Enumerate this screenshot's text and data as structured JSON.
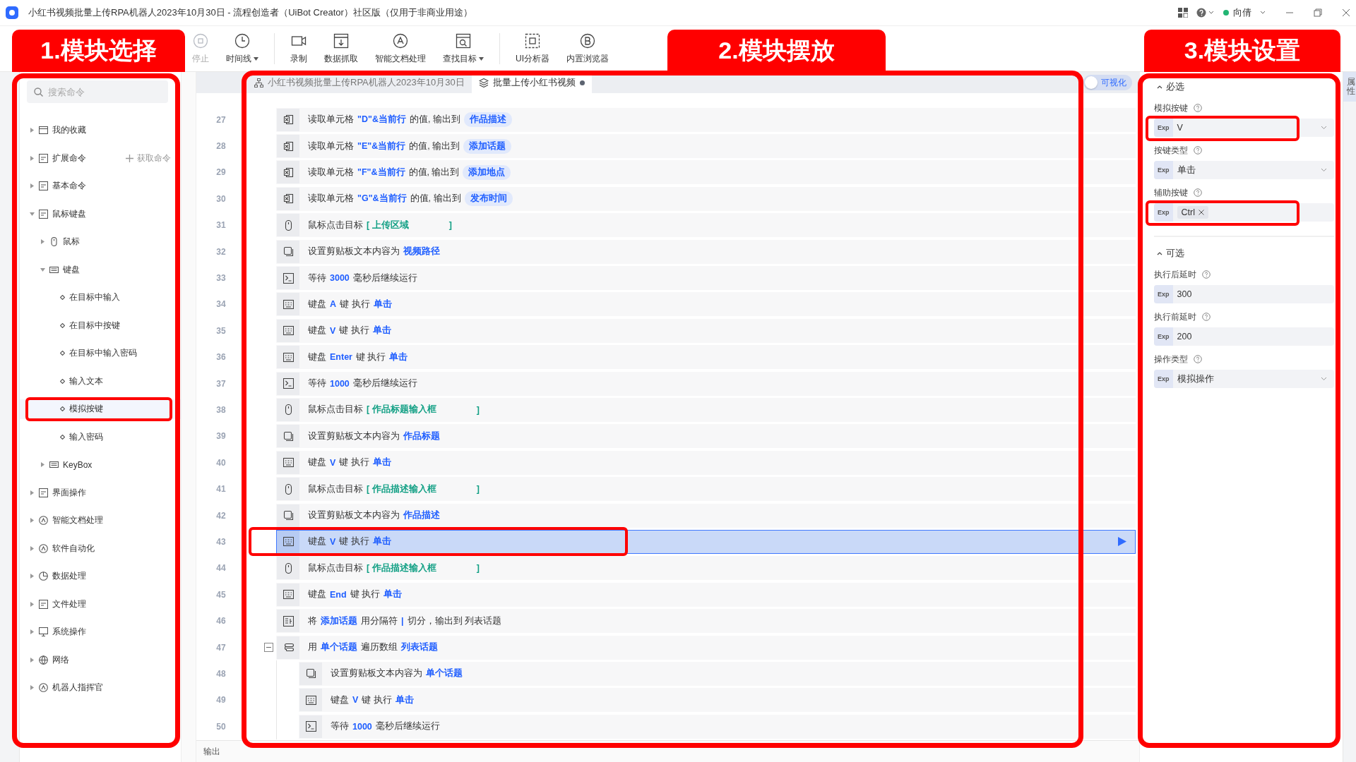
{
  "window": {
    "title": "小红书视频批量上传RPA机器人2023年10月30日 - 流程创造者（UiBot Creator）社区版（仅用于非商业用途）",
    "user": "向倩"
  },
  "toolbar": [
    {
      "label": "停止",
      "kind": "stop",
      "disabled": true,
      "dropdown": false
    },
    {
      "label": "时间线",
      "kind": "timeline",
      "disabled": false,
      "dropdown": true
    },
    {
      "label": "录制",
      "kind": "record",
      "disabled": false,
      "dropdown": false
    },
    {
      "label": "数据抓取",
      "kind": "scrape",
      "disabled": false,
      "dropdown": false
    },
    {
      "label": "智能文档处理",
      "kind": "ai-doc",
      "disabled": false,
      "dropdown": false
    },
    {
      "label": "查找目标",
      "kind": "find",
      "disabled": false,
      "dropdown": true
    },
    {
      "label": "UI分析器",
      "kind": "ui-analyzer",
      "disabled": false,
      "dropdown": false
    },
    {
      "label": "内置浏览器",
      "kind": "browser",
      "disabled": false,
      "dropdown": false
    }
  ],
  "annotations": [
    {
      "label": "1.模块选择"
    },
    {
      "label": "2.模块摆放"
    },
    {
      "label": "3.模块设置"
    }
  ],
  "sidebar": {
    "search_placeholder": "搜索命令",
    "get_commands": "获取命令",
    "items": [
      {
        "label": "我的收藏",
        "kind": "folder",
        "expanded": false
      },
      {
        "label": "扩展命令",
        "kind": "extension",
        "expanded": false
      },
      {
        "label": "基本命令",
        "kind": "code",
        "expanded": false
      },
      {
        "label": "鼠标键盘",
        "kind": "mouse-keyboard",
        "expanded": true,
        "children": [
          {
            "label": "鼠标",
            "kind": "mouse",
            "expanded": false
          },
          {
            "label": "键盘",
            "kind": "keyboard",
            "expanded": true,
            "children": [
              {
                "label": "在目标中输入",
                "kind": "command",
                "selected": false,
                "highlighted": false
              },
              {
                "label": "在目标中按键",
                "kind": "command",
                "selected": false,
                "highlighted": false
              },
              {
                "label": "在目标中输入密码",
                "kind": "command",
                "selected": false,
                "highlighted": false
              },
              {
                "label": "输入文本",
                "kind": "command",
                "selected": false,
                "highlighted": false
              },
              {
                "label": "模拟按键",
                "kind": "command",
                "selected": true,
                "highlighted": true
              },
              {
                "label": "输入密码",
                "kind": "command",
                "selected": false,
                "highlighted": false
              }
            ]
          },
          {
            "label": "KeyBox",
            "kind": "keybox",
            "expanded": false
          }
        ]
      },
      {
        "label": "界面操作",
        "kind": "ui",
        "expanded": false
      },
      {
        "label": "智能文档处理",
        "kind": "ai",
        "expanded": false
      },
      {
        "label": "软件自动化",
        "kind": "auto",
        "expanded": false
      },
      {
        "label": "数据处理",
        "kind": "chart",
        "expanded": false
      },
      {
        "label": "文件处理",
        "kind": "file",
        "expanded": false
      },
      {
        "label": "系统操作",
        "kind": "system",
        "expanded": false
      },
      {
        "label": "网络",
        "kind": "globe",
        "expanded": false
      },
      {
        "label": "机器人指挥官",
        "kind": "commander",
        "expanded": false
      }
    ]
  },
  "editor": {
    "tabs": [
      {
        "label": "小红书视频批量上传RPA机器人2023年10月30日",
        "kind": "flow",
        "selected": false,
        "modified": false
      },
      {
        "label": "批量上传小红书视频",
        "kind": "block",
        "selected": true,
        "modified": true
      }
    ],
    "visual_toggle": {
      "label": "可视化",
      "on": false
    },
    "rows": [
      {
        "line": "27",
        "kind": "read-cell",
        "selected": false,
        "highlighted": false,
        "parts": [
          {
            "kind": "text",
            "text": "读取单元格"
          },
          {
            "kind": "value",
            "text": "\"D\"&当前行"
          },
          {
            "kind": "text",
            "text": "的值, 输出到"
          },
          {
            "kind": "pill",
            "text": "作品描述"
          }
        ]
      },
      {
        "line": "28",
        "kind": "read-cell",
        "selected": false,
        "highlighted": false,
        "parts": [
          {
            "kind": "text",
            "text": "读取单元格"
          },
          {
            "kind": "value",
            "text": "\"E\"&当前行"
          },
          {
            "kind": "text",
            "text": "的值, 输出到"
          },
          {
            "kind": "pill",
            "text": "添加话题"
          }
        ]
      },
      {
        "line": "29",
        "kind": "read-cell",
        "selected": false,
        "highlighted": false,
        "parts": [
          {
            "kind": "text",
            "text": "读取单元格"
          },
          {
            "kind": "value",
            "text": "\"F\"&当前行"
          },
          {
            "kind": "text",
            "text": "的值, 输出到"
          },
          {
            "kind": "pill",
            "text": "添加地点"
          }
        ]
      },
      {
        "line": "30",
        "kind": "read-cell",
        "selected": false,
        "highlighted": false,
        "parts": [
          {
            "kind": "text",
            "text": "读取单元格"
          },
          {
            "kind": "value",
            "text": "\"G\"&当前行"
          },
          {
            "kind": "text",
            "text": "的值, 输出到"
          },
          {
            "kind": "pill",
            "text": "发布时间"
          }
        ]
      },
      {
        "line": "31",
        "kind": "click",
        "selected": false,
        "highlighted": false,
        "parts": [
          {
            "kind": "text",
            "text": "鼠标点击目标"
          },
          {
            "kind": "target",
            "text": "[ 上传区域"
          },
          {
            "kind": "target-end",
            "text": "]"
          }
        ]
      },
      {
        "line": "32",
        "kind": "clipboard",
        "selected": false,
        "highlighted": false,
        "parts": [
          {
            "kind": "text",
            "text": "设置剪贴板文本内容为"
          },
          {
            "kind": "value",
            "text": "视频路径"
          }
        ]
      },
      {
        "line": "33",
        "kind": "wait",
        "selected": false,
        "highlighted": false,
        "parts": [
          {
            "kind": "text",
            "text": "等待"
          },
          {
            "kind": "value",
            "text": "3000"
          },
          {
            "kind": "text",
            "text": "毫秒后继续运行"
          }
        ]
      },
      {
        "line": "34",
        "kind": "keyboard",
        "selected": false,
        "highlighted": false,
        "parts": [
          {
            "kind": "text",
            "text": "键盘"
          },
          {
            "kind": "value",
            "text": "A"
          },
          {
            "kind": "text",
            "text": "键 执行"
          },
          {
            "kind": "value",
            "text": "单击"
          }
        ]
      },
      {
        "line": "35",
        "kind": "keyboard",
        "selected": false,
        "highlighted": false,
        "parts": [
          {
            "kind": "text",
            "text": "键盘"
          },
          {
            "kind": "value",
            "text": "V"
          },
          {
            "kind": "text",
            "text": "键 执行"
          },
          {
            "kind": "value",
            "text": "单击"
          }
        ]
      },
      {
        "line": "36",
        "kind": "keyboard",
        "selected": false,
        "highlighted": false,
        "parts": [
          {
            "kind": "text",
            "text": "键盘"
          },
          {
            "kind": "value",
            "text": "Enter"
          },
          {
            "kind": "text",
            "text": "键 执行"
          },
          {
            "kind": "value",
            "text": "单击"
          }
        ]
      },
      {
        "line": "37",
        "kind": "wait",
        "selected": false,
        "highlighted": false,
        "parts": [
          {
            "kind": "text",
            "text": "等待"
          },
          {
            "kind": "value",
            "text": "1000"
          },
          {
            "kind": "text",
            "text": "毫秒后继续运行"
          }
        ]
      },
      {
        "line": "38",
        "kind": "click",
        "selected": false,
        "highlighted": false,
        "parts": [
          {
            "kind": "text",
            "text": "鼠标点击目标"
          },
          {
            "kind": "target",
            "text": "[ 作品标题输入框"
          },
          {
            "kind": "target-end",
            "text": "]"
          }
        ]
      },
      {
        "line": "39",
        "kind": "clipboard",
        "selected": false,
        "highlighted": false,
        "parts": [
          {
            "kind": "text",
            "text": "设置剪贴板文本内容为"
          },
          {
            "kind": "value",
            "text": "作品标题"
          }
        ]
      },
      {
        "line": "40",
        "kind": "keyboard",
        "selected": false,
        "highlighted": false,
        "parts": [
          {
            "kind": "text",
            "text": "键盘"
          },
          {
            "kind": "value",
            "text": "V"
          },
          {
            "kind": "text",
            "text": "键 执行"
          },
          {
            "kind": "value",
            "text": "单击"
          }
        ]
      },
      {
        "line": "41",
        "kind": "click",
        "selected": false,
        "highlighted": false,
        "parts": [
          {
            "kind": "text",
            "text": "鼠标点击目标"
          },
          {
            "kind": "target",
            "text": "[ 作品描述输入框"
          },
          {
            "kind": "target-end",
            "text": "]"
          }
        ]
      },
      {
        "line": "42",
        "kind": "clipboard",
        "selected": false,
        "highlighted": false,
        "parts": [
          {
            "kind": "text",
            "text": "设置剪贴板文本内容为"
          },
          {
            "kind": "value",
            "text": "作品描述"
          }
        ]
      },
      {
        "line": "43",
        "kind": "keyboard",
        "selected": true,
        "highlighted": true,
        "parts": [
          {
            "kind": "text",
            "text": "键盘"
          },
          {
            "kind": "value",
            "text": "V"
          },
          {
            "kind": "text",
            "text": "键 执行"
          },
          {
            "kind": "value",
            "text": "单击"
          }
        ]
      },
      {
        "line": "44",
        "kind": "click",
        "selected": false,
        "highlighted": false,
        "parts": [
          {
            "kind": "text",
            "text": "鼠标点击目标"
          },
          {
            "kind": "target",
            "text": "[ 作品描述输入框"
          },
          {
            "kind": "target-end",
            "text": "]"
          }
        ]
      },
      {
        "line": "45",
        "kind": "keyboard",
        "selected": false,
        "highlighted": false,
        "parts": [
          {
            "kind": "text",
            "text": "键盘"
          },
          {
            "kind": "value",
            "text": "End"
          },
          {
            "kind": "text",
            "text": "键 执行"
          },
          {
            "kind": "value",
            "text": "单击"
          }
        ]
      },
      {
        "line": "46",
        "kind": "split",
        "selected": false,
        "highlighted": false,
        "parts": [
          {
            "kind": "text",
            "text": "将"
          },
          {
            "kind": "value",
            "text": "添加话题"
          },
          {
            "kind": "text",
            "text": "用分隔符"
          },
          {
            "kind": "value",
            "text": "|"
          },
          {
            "kind": "text",
            "text": "切分，输出到 列表话题"
          }
        ]
      },
      {
        "line": "47",
        "kind": "loop",
        "selected": false,
        "highlighted": false,
        "expanded": true,
        "parts": [
          {
            "kind": "text",
            "text": "用"
          },
          {
            "kind": "value",
            "text": "单个话题"
          },
          {
            "kind": "text",
            "text": "遍历数组"
          },
          {
            "kind": "value",
            "text": "列表话题"
          }
        ],
        "children": [
          {
            "line": "48",
            "kind": "clipboard",
            "selected": false,
            "highlighted": false,
            "parts": [
              {
                "kind": "text",
                "text": "设置剪贴板文本内容为"
              },
              {
                "kind": "value",
                "text": "单个话题"
              }
            ]
          },
          {
            "line": "49",
            "kind": "keyboard",
            "selected": false,
            "highlighted": false,
            "parts": [
              {
                "kind": "text",
                "text": "键盘"
              },
              {
                "kind": "value",
                "text": "V"
              },
              {
                "kind": "text",
                "text": "键 执行"
              },
              {
                "kind": "value",
                "text": "单击"
              }
            ]
          },
          {
            "line": "50",
            "kind": "wait",
            "selected": false,
            "highlighted": false,
            "parts": [
              {
                "kind": "text",
                "text": "等待"
              },
              {
                "kind": "value",
                "text": "1000"
              },
              {
                "kind": "text",
                "text": "毫秒后继续运行"
              }
            ]
          }
        ]
      }
    ],
    "output_label": "输出"
  },
  "properties": {
    "sections": [
      {
        "title": "必选",
        "expanded": true,
        "fields": [
          {
            "label": "模拟按键",
            "kind": "select",
            "prefix": "Exp",
            "value": "V",
            "highlighted": true
          },
          {
            "label": "按键类型",
            "kind": "select",
            "prefix": "Exp",
            "value": "单击",
            "highlighted": false
          },
          {
            "label": "辅助按键",
            "kind": "tags",
            "prefix": "Exp",
            "tags": [
              "Ctrl"
            ],
            "highlighted": true
          }
        ]
      },
      {
        "title": "可选",
        "expanded": true,
        "fields": [
          {
            "label": "执行后延时",
            "kind": "input",
            "prefix": "Exp",
            "value": "300",
            "highlighted": false
          },
          {
            "label": "执行前延时",
            "kind": "input",
            "prefix": "Exp",
            "value": "200",
            "highlighted": false
          },
          {
            "label": "操作类型",
            "kind": "select",
            "prefix": "Exp",
            "value": "模拟操作",
            "highlighted": false
          }
        ]
      }
    ],
    "side_tabs": [
      {
        "label": "属性",
        "selected": true
      }
    ]
  }
}
